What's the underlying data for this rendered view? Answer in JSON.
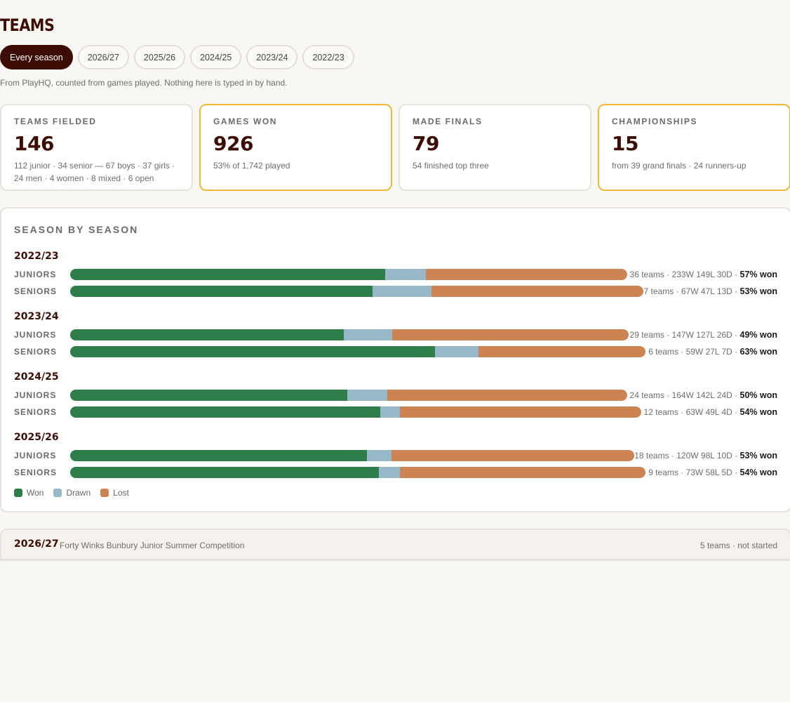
{
  "page": {
    "title": "TEAMS"
  },
  "tabs": [
    {
      "label": "Every season",
      "active": true
    },
    {
      "label": "2026/27",
      "active": false
    },
    {
      "label": "2025/26",
      "active": false
    },
    {
      "label": "2024/25",
      "active": false
    },
    {
      "label": "2023/24",
      "active": false
    },
    {
      "label": "2022/23",
      "active": false
    }
  ],
  "source_note": "From PlayHQ, counted from games played. Nothing here is typed in by hand.",
  "cards": [
    {
      "label": "TEAMS FIELDED",
      "value": "146",
      "detail_line1": "112 junior · 34 senior — 67 boys · 37 girls ·",
      "detail_line2": "24 men · 4 women · 8 mixed · 6 open"
    },
    {
      "label": "GAMES WON",
      "value": "926",
      "detail_line1": "53% of 1,742 played",
      "detail_line2": ""
    },
    {
      "label": "MADE FINALS",
      "value": "79",
      "detail_line1": "54 finished top three",
      "detail_line2": ""
    },
    {
      "label": "CHAMPIONSHIPS",
      "value": "15",
      "detail_line1": "from 39 grand finals · 24 runners-up",
      "detail_line2": ""
    }
  ],
  "season_panel": {
    "title": "SEASON BY SEASON",
    "seasons": [
      {
        "season": "2022/23",
        "rows": [
          {
            "label": "JUNIORS",
            "won": 233,
            "drawn": 30,
            "lost": 149,
            "stats": "36 teams · 233W 149L 30D · ",
            "pct": "57% won"
          },
          {
            "label": "SENIORS",
            "won": 67,
            "drawn": 13,
            "lost": 47,
            "stats": "7 teams · 67W 47L 13D · ",
            "pct": "53% won"
          }
        ]
      },
      {
        "season": "2023/24",
        "rows": [
          {
            "label": "JUNIORS",
            "won": 147,
            "drawn": 26,
            "lost": 127,
            "stats": "29 teams · 147W 127L 26D · ",
            "pct": "49% won"
          },
          {
            "label": "SENIORS",
            "won": 59,
            "drawn": 7,
            "lost": 27,
            "stats": "6 teams · 59W 27L 7D · ",
            "pct": "63% won"
          }
        ]
      },
      {
        "season": "2024/25",
        "rows": [
          {
            "label": "JUNIORS",
            "won": 164,
            "drawn": 24,
            "lost": 142,
            "stats": "24 teams · 164W 142L 24D · ",
            "pct": "50% won"
          },
          {
            "label": "SENIORS",
            "won": 63,
            "drawn": 4,
            "lost": 49,
            "stats": "12 teams · 63W 49L 4D · ",
            "pct": "54% won"
          }
        ]
      },
      {
        "season": "2025/26",
        "rows": [
          {
            "label": "JUNIORS",
            "won": 120,
            "drawn": 10,
            "lost": 98,
            "stats": "18 teams · 120W 98L 10D · ",
            "pct": "53% won"
          },
          {
            "label": "SENIORS",
            "won": 73,
            "drawn": 5,
            "lost": 58,
            "stats": "9 teams · 73W 58L 5D · ",
            "pct": "54% won"
          }
        ]
      }
    ],
    "legend": [
      {
        "label": "Won",
        "color": "#2e7d4a"
      },
      {
        "label": "Drawn",
        "color": "#97b8c9"
      },
      {
        "label": "Lost",
        "color": "#cc8552"
      }
    ]
  },
  "upcoming": {
    "season": "2026/27",
    "competition": "Forty Winks Bunbury Junior Summer Competition",
    "status": "5 teams · not started"
  },
  "colors": {
    "brand_dark": "#3d0c02",
    "highlight_border": "#f2b735",
    "won": "#2e7d4a",
    "drawn": "#97b8c9",
    "lost": "#cc8552"
  }
}
